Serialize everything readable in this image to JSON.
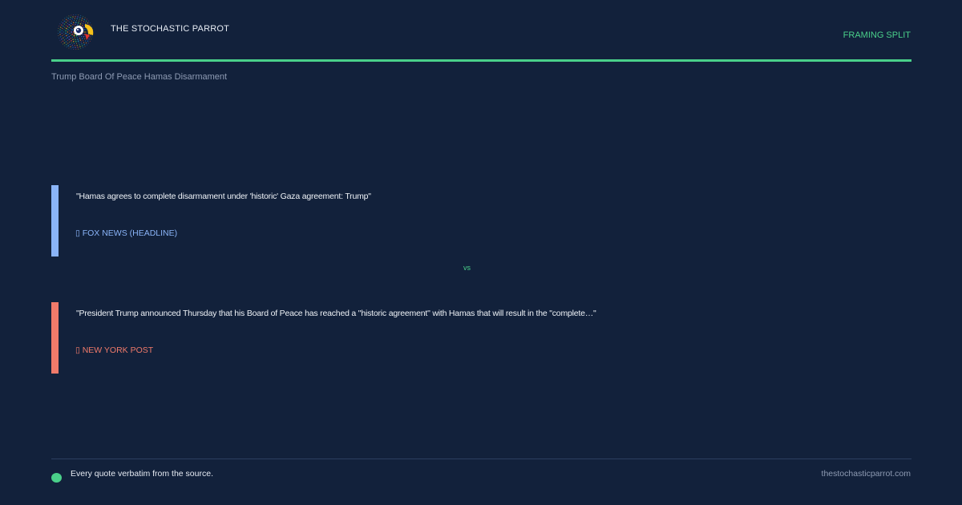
{
  "header": {
    "brand": "THE STOCHASTIC PARROT",
    "tag": "FRAMING SPLIT"
  },
  "topic": "Trump Board Of Peace Hamas Disarmament",
  "quotes": [
    {
      "text": "\"Hamas agrees to complete disarmament under 'historic' Gaza agreement: Trump\"",
      "source": "▯ FOX NEWS (HEADLINE)",
      "color": "#8ab4f8"
    },
    {
      "text": "\"President Trump announced Thursday that his Board of Peace has reached a \"historic agreement\" with Hamas that will result in the \"complete…\"",
      "source": "▯ NEW YORK POST",
      "color": "#f07a6a"
    }
  ],
  "divider": "vs",
  "footer": {
    "note": "Every quote verbatim from the source.",
    "site": "thestochasticparrot.com"
  },
  "colors": {
    "background": "#12213b",
    "accent": "#4ad08a"
  },
  "icons": {
    "logo": "parrot-logo-icon",
    "footer_dot": "green-dot-icon"
  }
}
